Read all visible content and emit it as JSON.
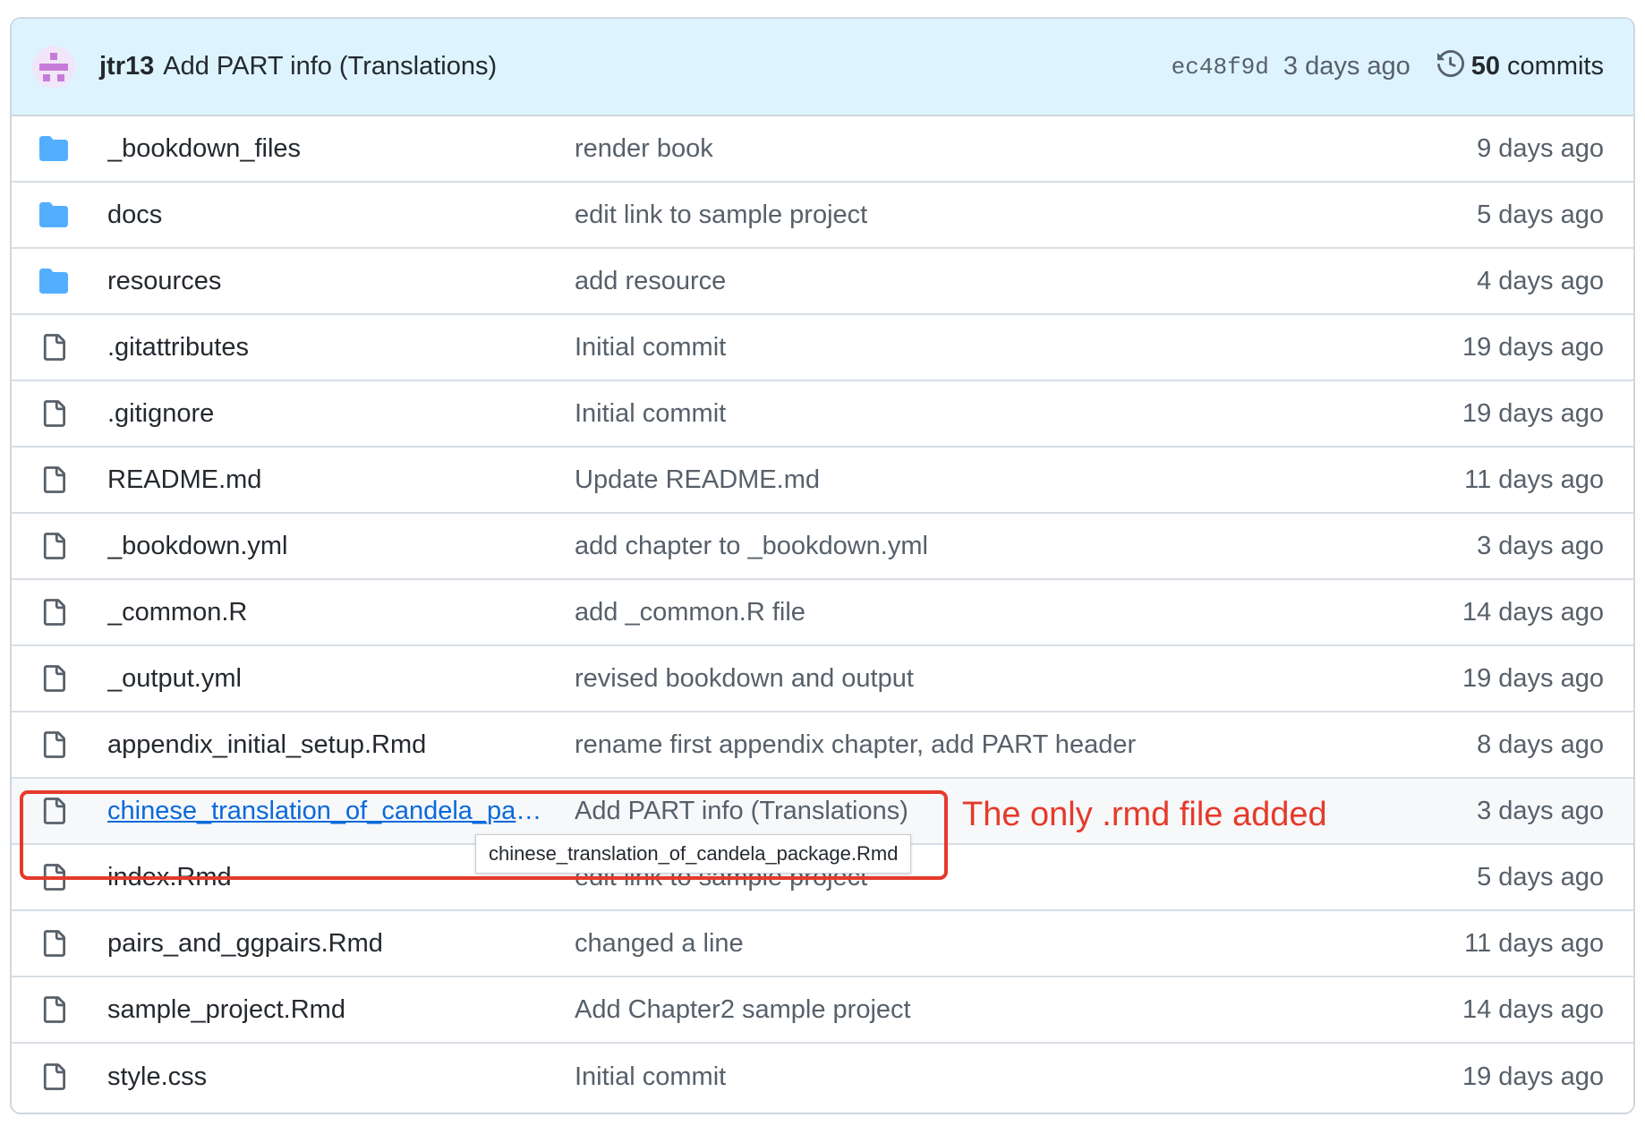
{
  "commit": {
    "author": "jtr13",
    "message": "Add PART info (Translations)",
    "sha": "ec48f9d",
    "time": "3 days ago",
    "commits_count": "50",
    "commits_label": "commits"
  },
  "files": [
    {
      "type": "folder",
      "name": "_bookdown_files",
      "message": "render book",
      "age": "9 days ago"
    },
    {
      "type": "folder",
      "name": "docs",
      "message": "edit link to sample project",
      "age": "5 days ago"
    },
    {
      "type": "folder",
      "name": "resources",
      "message": "add resource",
      "age": "4 days ago"
    },
    {
      "type": "file",
      "name": ".gitattributes",
      "message": "Initial commit",
      "age": "19 days ago"
    },
    {
      "type": "file",
      "name": ".gitignore",
      "message": "Initial commit",
      "age": "19 days ago"
    },
    {
      "type": "file",
      "name": "README.md",
      "message": "Update README.md",
      "age": "11 days ago"
    },
    {
      "type": "file",
      "name": "_bookdown.yml",
      "message": "add chapter to _bookdown.yml",
      "age": "3 days ago"
    },
    {
      "type": "file",
      "name": "_common.R",
      "message": "add _common.R file",
      "age": "14 days ago"
    },
    {
      "type": "file",
      "name": "_output.yml",
      "message": "revised bookdown and output",
      "age": "19 days ago"
    },
    {
      "type": "file",
      "name": "appendix_initial_setup.Rmd",
      "message": "rename first appendix chapter, add PART header",
      "age": "8 days ago"
    },
    {
      "type": "file",
      "name": "chinese_translation_of_candela_pac...",
      "message": "Add PART info (Translations)",
      "age": "3 days ago"
    },
    {
      "type": "file",
      "name": "index.Rmd",
      "message": "edit link to sample project",
      "age": "5 days ago"
    },
    {
      "type": "file",
      "name": "pairs_and_ggpairs.Rmd",
      "message": "changed a line",
      "age": "11 days ago"
    },
    {
      "type": "file",
      "name": "sample_project.Rmd",
      "message": "Add Chapter2 sample project",
      "age": "14 days ago"
    },
    {
      "type": "file",
      "name": "style.css",
      "message": "Initial commit",
      "age": "19 days ago"
    }
  ],
  "tooltip": "chinese_translation_of_candela_package.Rmd",
  "annotation": "The only .rmd file added",
  "colors": {
    "header_bg": "#ddf4ff",
    "folder": "#54aeff",
    "link": "#0969da",
    "annotation": "#e53a2a"
  }
}
